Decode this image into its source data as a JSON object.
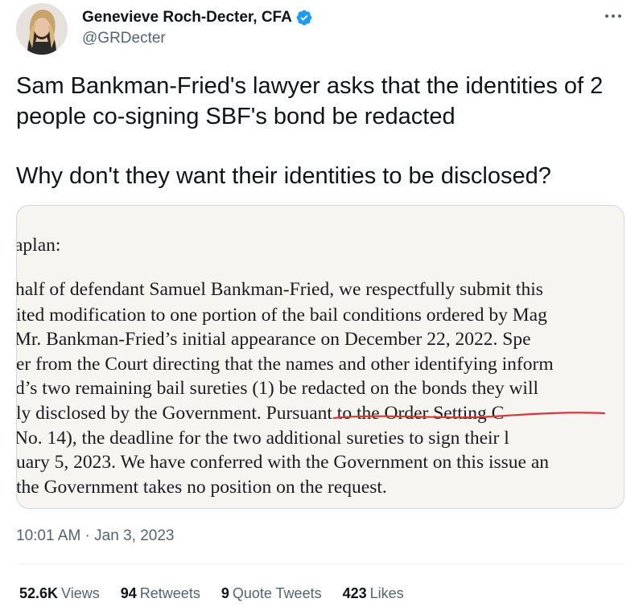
{
  "author": {
    "display_name": "Genevieve Roch-Decter, CFA",
    "handle": "@GRDecter",
    "verified": true
  },
  "tweet": {
    "paragraphs": [
      "Sam Bankman-Fried's lawyer asks that the identities of 2 people co-signing SBF's bond be redacted",
      "Why don't they want their identities to be disclosed?"
    ]
  },
  "media": {
    "lines": [
      "aplan:",
      "half of defendant Samuel Bankman-Fried, we respectfully submit this",
      "ited modification to one portion of the bail conditions ordered by Mag",
      " Mr. Bankman-Fried’s initial appearance on December 22, 2022.  Spe",
      "er from the Court directing that the names and other identifying inform",
      "d’s two remaining bail sureties (1) be redacted on the bonds they will",
      "ly disclosed by the Government.  Pursuant to the Order Setting C",
      " No. 14), the deadline for the two additional sureties to sign their l",
      "uary 5, 2023.  We have conferred with the Government on this issue an",
      "the Government takes no position on the request."
    ]
  },
  "timestamp": "10:01 AM · Jan 3, 2023",
  "stats": {
    "views": {
      "count": "52.6K",
      "label": "Views"
    },
    "retweets": {
      "count": "94",
      "label": "Retweets"
    },
    "quote_tweets": {
      "count": "9",
      "label": "Quote Tweets"
    },
    "likes": {
      "count": "423",
      "label": "Likes"
    }
  },
  "colors": {
    "verified_badge": "#1d9bf0",
    "secondary_text": "#536471",
    "primary_text": "#0f1419",
    "strike_red": "#d33a3a"
  },
  "icons": {
    "verified": "verified-badge-icon",
    "more": "more-dots-icon"
  }
}
